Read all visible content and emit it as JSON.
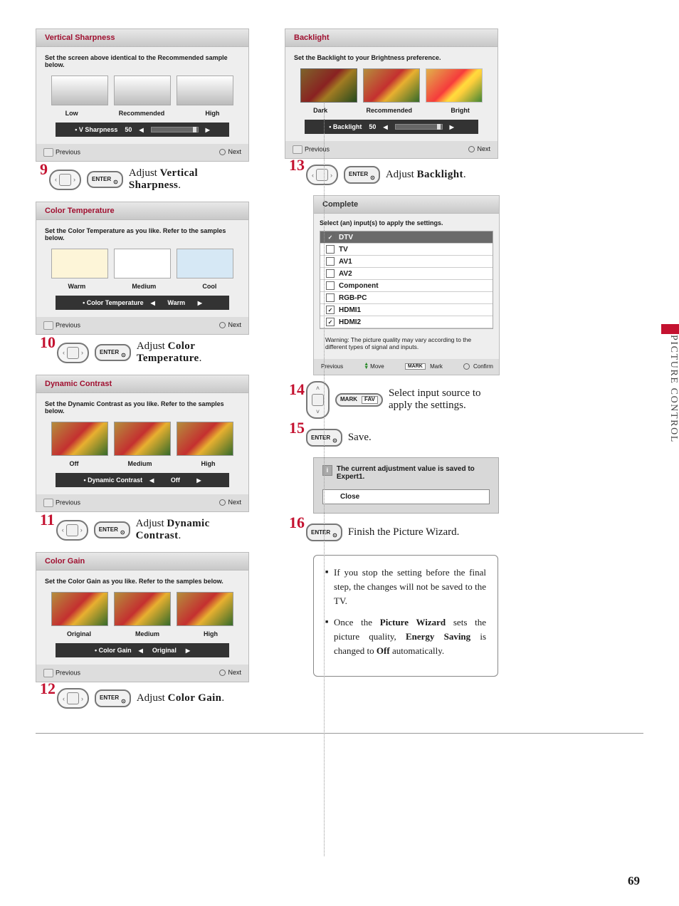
{
  "page_number": "69",
  "section_title": "PICTURE CONTROL",
  "panels": {
    "vsharp": {
      "title": "Vertical Sharpness",
      "desc": "Set the screen above identical to the Recommended sample below.",
      "labels": [
        "Low",
        "Recommended",
        "High"
      ],
      "slider_label": "• V Sharpness",
      "slider_value": "50",
      "prev": "Previous",
      "next": "Next"
    },
    "colortemp": {
      "title": "Color Temperature",
      "desc": "Set the Color Temperature as you like. Refer to the samples below.",
      "labels": [
        "Warm",
        "Medium",
        "Cool"
      ],
      "slider_label": "• Color Temperature",
      "slider_value": "Warm",
      "prev": "Previous",
      "next": "Next"
    },
    "dyn": {
      "title": "Dynamic Contrast",
      "desc": "Set the Dynamic Contrast as you like. Refer to the samples below.",
      "labels": [
        "Off",
        "Medium",
        "High"
      ],
      "slider_label": "• Dynamic Contrast",
      "slider_value": "Off",
      "prev": "Previous",
      "next": "Next"
    },
    "gain": {
      "title": "Color Gain",
      "desc": "Set the Color Gain as you like. Refer to the samples below.",
      "labels": [
        "Original",
        "Medium",
        "High"
      ],
      "slider_label": "• Color Gain",
      "slider_value": "Original",
      "prev": "Previous",
      "next": "Next"
    },
    "backlight": {
      "title": "Backlight",
      "desc": "Set the Backlight to your Brightness preference.",
      "labels": [
        "Dark",
        "Recommended",
        "Bright"
      ],
      "slider_label": "• Backlight",
      "slider_value": "50",
      "prev": "Previous",
      "next": "Next"
    },
    "complete": {
      "title": "Complete",
      "desc": "Select (an) input(s) to apply the settings.",
      "inputs": [
        {
          "name": "DTV",
          "checked": true,
          "sel": true
        },
        {
          "name": "TV",
          "checked": false
        },
        {
          "name": "AV1",
          "checked": false
        },
        {
          "name": "AV2",
          "checked": false
        },
        {
          "name": "Component",
          "checked": false
        },
        {
          "name": "RGB-PC",
          "checked": false
        },
        {
          "name": "HDMI1",
          "checked": true
        },
        {
          "name": "HDMI2",
          "checked": true
        }
      ],
      "warning": "Warning: The picture quality may vary according to the different types of signal and inputs.",
      "prev": "Previous",
      "move": "Move",
      "mark_box": "MARK",
      "mark": "Mark",
      "confirm": "Confirm"
    }
  },
  "steps": {
    "s9": {
      "num": "9",
      "text_pre": "Adjust ",
      "bold": "Vertical Sharpness",
      "text_post": "."
    },
    "s10": {
      "num": "10",
      "text_pre": "Adjust ",
      "bold": "Color Temperature",
      "text_post": "."
    },
    "s11": {
      "num": "11",
      "text_pre": "Adjust ",
      "bold": "Dynamic Contrast",
      "text_post": "."
    },
    "s12": {
      "num": "12",
      "text_pre": "Adjust ",
      "bold": "Color Gain",
      "text_post": "."
    },
    "s13": {
      "num": "13",
      "text_pre": "Adjust ",
      "bold": "Backlight",
      "text_post": "."
    },
    "s14": {
      "num": "14",
      "text": "Select input source to apply the settings."
    },
    "s15": {
      "num": "15",
      "text": "Save."
    },
    "s16": {
      "num": "16",
      "text": "Finish the Picture Wizard."
    }
  },
  "buttons": {
    "enter": "ENTER",
    "mark": "MARK",
    "fav": "FAV"
  },
  "save_dialog": {
    "msg": "The current adjustment value is saved to Expert1.",
    "close": "Close"
  },
  "notes": {
    "n1": "If you stop the setting before the final step, the changes will not be saved to the TV.",
    "n2a": "Once the ",
    "n2b": "Picture Wizard",
    "n2c": " sets the picture quality, ",
    "n2d": "Energy Saving",
    "n2e": " is changed to ",
    "n2f": "Off",
    "n2g": " automatically."
  }
}
